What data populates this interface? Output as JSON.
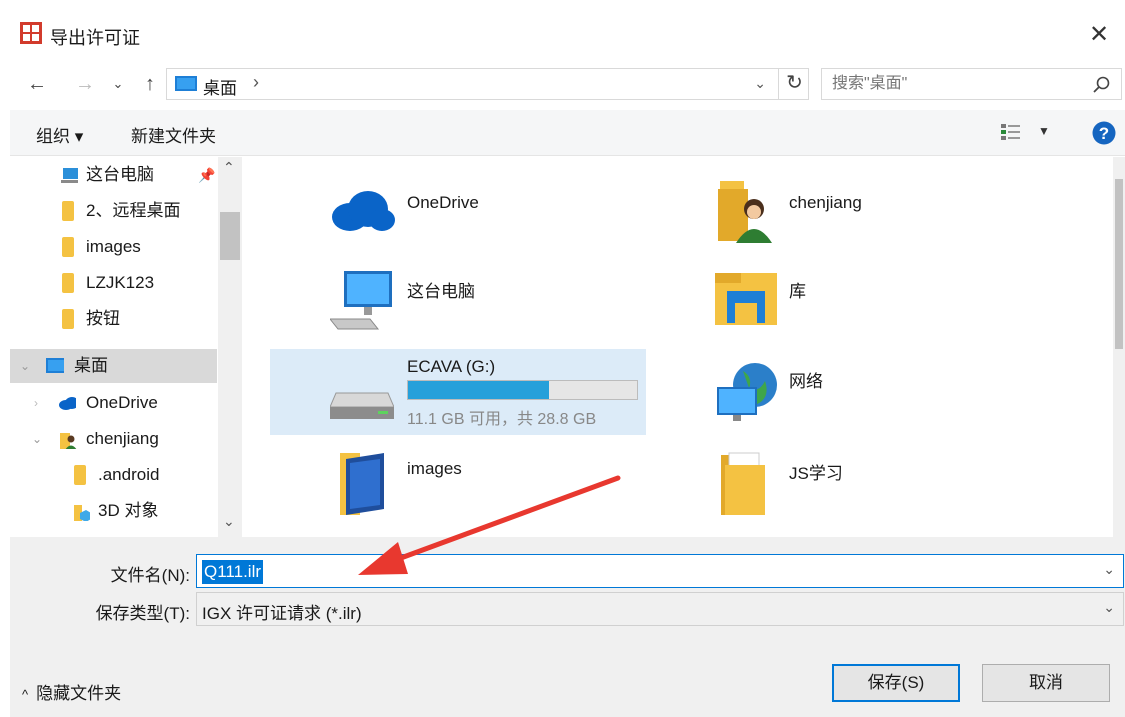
{
  "window": {
    "title": "导出许可证",
    "close_label": "✕"
  },
  "address": {
    "location": "桌面",
    "separator": "›",
    "search_placeholder": "搜索\"桌面\""
  },
  "toolbar": {
    "organize": "组织 ▾",
    "new_folder": "新建文件夹"
  },
  "nav": {
    "items": [
      {
        "label": "这台电脑",
        "icon": "computer-icon"
      },
      {
        "label": "2、远程桌面",
        "icon": "folder-icon"
      },
      {
        "label": "images",
        "icon": "folder-icon"
      },
      {
        "label": "LZJK123",
        "icon": "folder-icon"
      },
      {
        "label": "按钮",
        "icon": "folder-icon"
      },
      {
        "label": "桌面",
        "icon": "desktop-icon"
      },
      {
        "label": "OneDrive",
        "icon": "cloud-icon"
      },
      {
        "label": "chenjiang",
        "icon": "user-folder-icon"
      },
      {
        "label": ".android",
        "icon": "folder-icon"
      },
      {
        "label": "3D 对象",
        "icon": "3d-objects-icon"
      }
    ]
  },
  "content": {
    "tiles": [
      {
        "label": "OneDrive",
        "icon": "onedrive-icon"
      },
      {
        "label": "chenjiang",
        "icon": "user-folder-icon"
      },
      {
        "label": "这台电脑",
        "icon": "computer-icon"
      },
      {
        "label": "库",
        "icon": "library-icon"
      },
      {
        "label": "ECAVA (G:)",
        "icon": "drive-icon",
        "sub": "11.1 GB 可用，共 28.8 GB",
        "used_fraction": 0.615
      },
      {
        "label": "网络",
        "icon": "network-icon"
      },
      {
        "label": "images",
        "icon": "folder-icon"
      },
      {
        "label": "JS学习",
        "icon": "folder-icon"
      }
    ]
  },
  "form": {
    "filename_label": "文件名(N):",
    "filename_value": "Q111.ilr",
    "type_label": "保存类型(T):",
    "type_value": "IGX 许可证请求 (*.ilr)"
  },
  "footer": {
    "hide_folders": "隐藏文件夹",
    "save": "保存(S)",
    "cancel": "取消"
  },
  "colors": {
    "accent": "#0078d7",
    "arrow": "#e8382f",
    "selection": "#dcebf8"
  }
}
